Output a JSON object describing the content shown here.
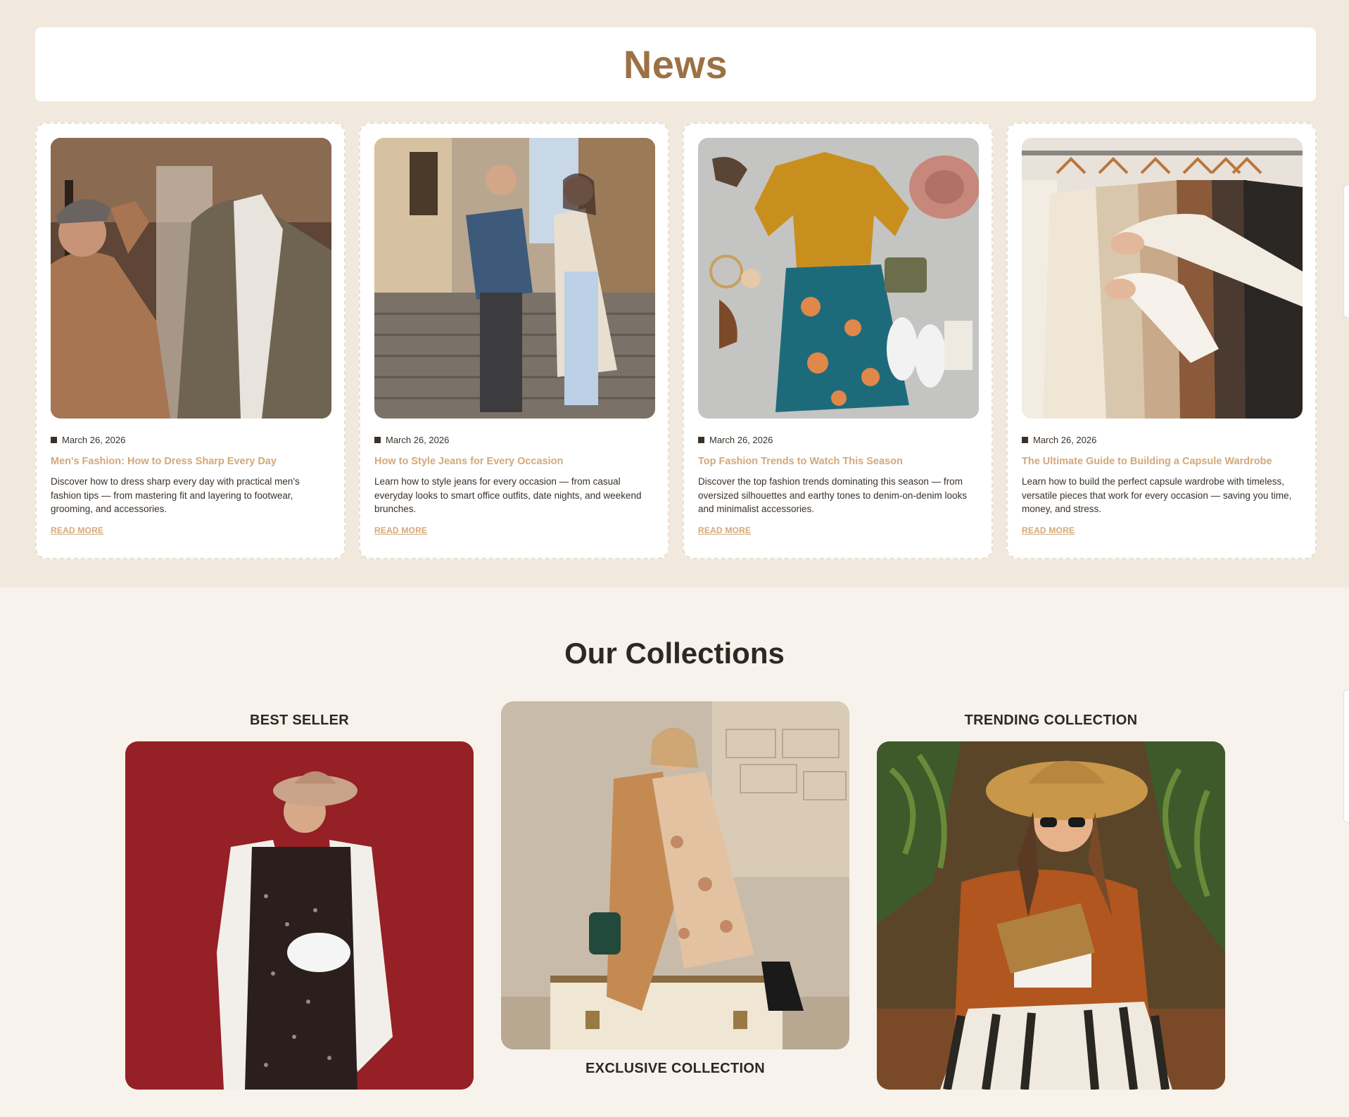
{
  "news": {
    "title": "News",
    "read_more_label": "READ MORE",
    "cards": [
      {
        "date": "March 26, 2026",
        "title": "Men's Fashion: How to Dress Sharp Every Day",
        "description": "Discover how to dress sharp every day with practical men's fashion tips — from mastering fit and layering to footwear, grooming, and accessories.",
        "image": "man-in-tan-coat-photo"
      },
      {
        "date": "March 26, 2026",
        "title": "How to Style Jeans for Every Occasion",
        "description": "Learn how to style jeans for every occasion — from casual everyday looks to smart office outfits, date nights, and weekend brunches.",
        "image": "couple-on-street-stairs-photo"
      },
      {
        "date": "March 26, 2026",
        "title": "Top Fashion Trends to Watch This Season",
        "description": "Discover the top fashion trends dominating this season — from oversized silhouettes and earthy tones to denim-on-denim looks and minimalist accessories.",
        "image": "flatlay-sweater-skirt-photo"
      },
      {
        "date": "March 26, 2026",
        "title": "The Ultimate Guide to Building a Capsule Wardrobe",
        "description": "Learn how to build the perfect capsule wardrobe with timeless, versatile pieces that work for every occasion — saving you time, money, and stress.",
        "image": "clothing-rack-photo"
      }
    ]
  },
  "collections": {
    "title": "Our Collections",
    "items": [
      {
        "label": "BEST SELLER",
        "image": "woman-red-backdrop-photo"
      },
      {
        "label": "EXCLUSIVE COLLECTION",
        "image": "woman-on-suitcase-photo"
      },
      {
        "label": "TRENDING COLLECTION",
        "image": "woman-straw-hat-photo"
      }
    ]
  },
  "colors": {
    "accent": "#9b7245",
    "link": "#d4a878",
    "news_bg": "#f1e9dd",
    "page_bg": "#f7f2eb"
  }
}
